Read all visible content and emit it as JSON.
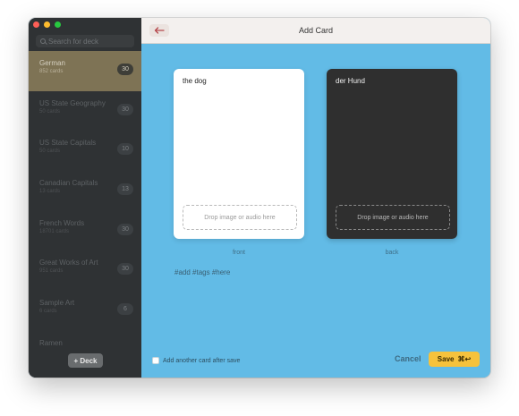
{
  "window": {
    "title": "Add Card"
  },
  "sidebar": {
    "search_placeholder": "Search for deck",
    "decks": [
      {
        "name": "German",
        "count_text": "852 cards",
        "badge": "30",
        "selected": true
      },
      {
        "name": "US State Geography",
        "count_text": "50 cards",
        "badge": "30"
      },
      {
        "name": "US State Capitals",
        "count_text": "50 cards",
        "badge": "10"
      },
      {
        "name": "Canadian Capitals",
        "count_text": "13 cards",
        "badge": "13"
      },
      {
        "name": "French Words",
        "count_text": "18701 cards",
        "badge": "30"
      },
      {
        "name": "Great Works of Art",
        "count_text": "951 cards",
        "badge": "30"
      },
      {
        "name": "Sample Art",
        "count_text": "6 cards",
        "badge": "6"
      },
      {
        "name": "Ramen",
        "count_text": "",
        "badge": ""
      }
    ],
    "add_deck_label": "+ Deck"
  },
  "toolbar": {
    "back_icon": "arrow-left-icon",
    "back_color": "#b5474c"
  },
  "cards": {
    "front": {
      "text": "the dog",
      "drop_text": "Drop image or audio here",
      "label": "front"
    },
    "back": {
      "text": "der Hund",
      "drop_text": "Drop image or audio here",
      "label": "back"
    }
  },
  "tags": "#add #tags #here",
  "footer": {
    "add_another_label": "Add another card after save",
    "cancel_label": "Cancel",
    "save_label": "Save",
    "save_shortcut": "⌘↩"
  },
  "colors": {
    "main_bg": "#62bbe6",
    "sidebar_bg": "#2f3234",
    "selected_deck_bg": "#7e7355",
    "save_bg": "#f6c23c",
    "back_card_bg": "#2f2f2f"
  }
}
